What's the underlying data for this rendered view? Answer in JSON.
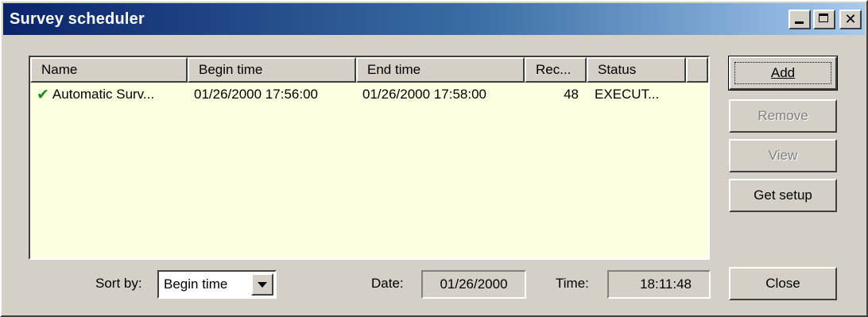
{
  "window": {
    "title": "Survey scheduler"
  },
  "list": {
    "columns": [
      "Name",
      "Begin time",
      "End time",
      "Rec...",
      "Status",
      ""
    ],
    "rows": [
      {
        "icon": "check-icon",
        "name": "Automatic Surv...",
        "begin": "01/26/2000 17:56:00",
        "end": "01/26/2000 17:58:00",
        "rec": "48",
        "status": "EXECUT..."
      }
    ]
  },
  "buttons": {
    "add": "Add",
    "remove": "Remove",
    "view": "View",
    "get_setup": "Get setup",
    "close": "Close"
  },
  "footer": {
    "sort_label": "Sort by:",
    "sort_value": "Begin time",
    "date_label": "Date:",
    "date_value": "01/26/2000",
    "time_label": "Time:",
    "time_value": "18:11:48"
  },
  "colors": {
    "titlebar_start": "#0a246a",
    "titlebar_end": "#a6caf0",
    "list_background": "#ffffe1",
    "face": "#d4d0c8",
    "check": "#1e8c1e"
  }
}
